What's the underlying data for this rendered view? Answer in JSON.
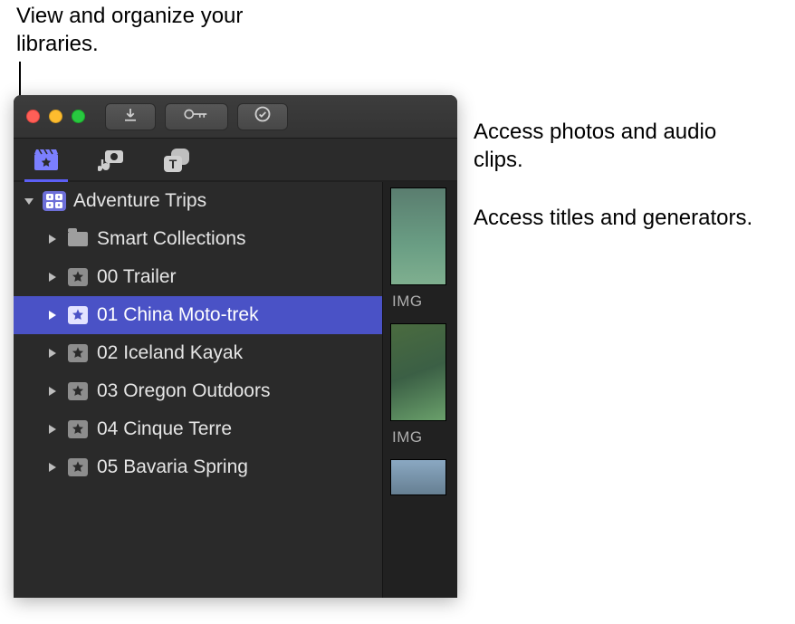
{
  "callouts": {
    "libraries": "View and organize your libraries.",
    "photos_audio": "Access photos and audio clips.",
    "titles_gens": "Access titles and generators."
  },
  "library_name": "Adventure Trips",
  "rows": [
    {
      "label": "Smart Collections",
      "type": "folder"
    },
    {
      "label": "00 Trailer",
      "type": "event"
    },
    {
      "label": "01 China Moto-trek",
      "type": "event",
      "selected": true
    },
    {
      "label": "02 Iceland Kayak",
      "type": "event"
    },
    {
      "label": "03 Oregon Outdoors",
      "type": "event"
    },
    {
      "label": "04 Cinque Terre",
      "type": "event"
    },
    {
      "label": "05 Bavaria Spring",
      "type": "event"
    }
  ],
  "thumb_labels": {
    "t1": "IMG",
    "t2": "IMG"
  }
}
